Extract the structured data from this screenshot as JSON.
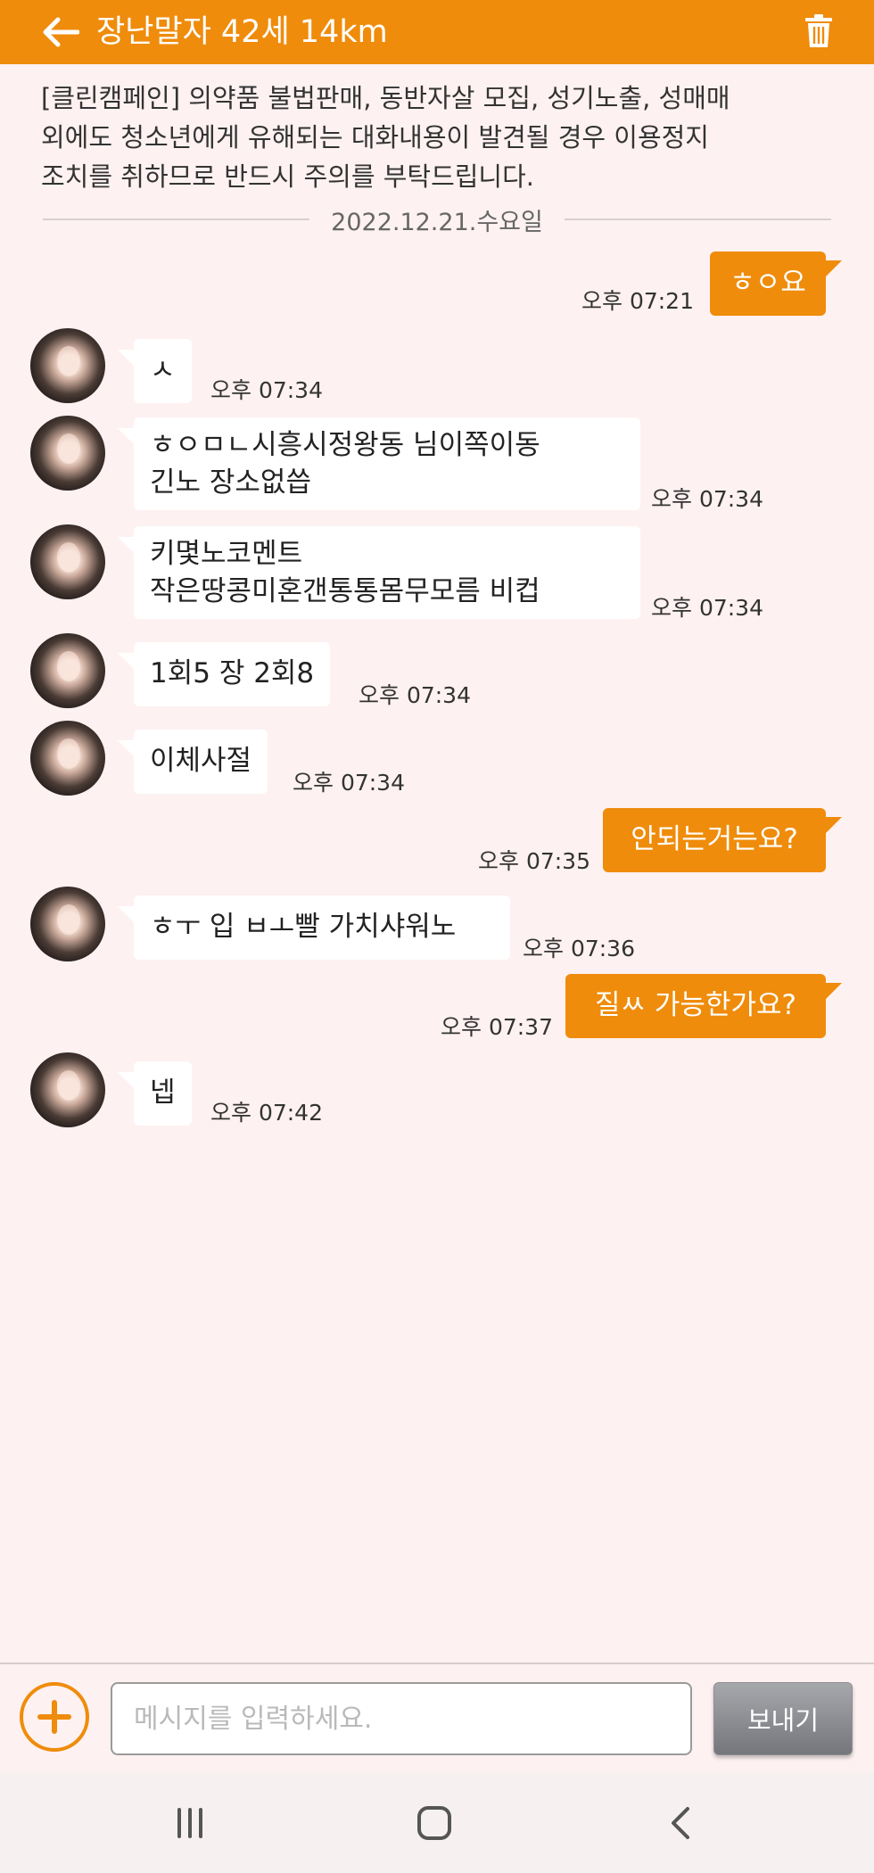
{
  "header": {
    "title": "장난말자 42세 14km",
    "back_icon": "arrow-left-icon",
    "trash_icon": "trash-icon",
    "color": "#ef8c0b"
  },
  "notice": {
    "lines": [
      "[클린캠페인] 의약품 불법판매, 동반자살 모집, 성기노출, 성매매",
      "외에도 청소년에게 유해되는 대화내용이 발견될 경우 이용정지",
      "조치를 취하므로 반드시 주의를 부탁드립니다."
    ]
  },
  "date_separator": "2022.12.21.수요일",
  "messages": [
    {
      "dir": "out",
      "lines": [
        "ㅎㅇ요"
      ],
      "time": "오후 07:21"
    },
    {
      "dir": "in",
      "lines": [
        "ㅅ"
      ],
      "time": "오후 07:34"
    },
    {
      "dir": "in",
      "lines": [
        "ㅎㅇㅁㄴ시흥시정왕동 님이쪽이동",
        "긴노 장소없씁"
      ],
      "time": "오후 07:34"
    },
    {
      "dir": "in",
      "lines": [
        "키몇노코멘트",
        "작은땅콩미혼갠통통몸무모름 비컵"
      ],
      "time": "오후 07:34"
    },
    {
      "dir": "in",
      "lines": [
        "1회5 장  2회8"
      ],
      "time": "오후 07:34"
    },
    {
      "dir": "in",
      "lines": [
        "이체사절"
      ],
      "time": "오후 07:34"
    },
    {
      "dir": "out",
      "lines": [
        "안되는거는요?"
      ],
      "time": "오후 07:35"
    },
    {
      "dir": "in",
      "lines": [
        "ㅎㅜ 입  ㅂㅗ빨 가치샤워노"
      ],
      "time": "오후 07:36"
    },
    {
      "dir": "out",
      "lines": [
        "질ㅆ 가능한가요?"
      ],
      "time": "오후 07:37"
    },
    {
      "dir": "in",
      "lines": [
        "넵"
      ],
      "time": "오후 07:42"
    }
  ],
  "input": {
    "placeholder": "메시지를 입력하세요.",
    "value": "",
    "plus_icon": "plus-circle-icon",
    "send_label": "보내기"
  },
  "nav": {
    "recent_icon": "recent-apps-icon",
    "home_icon": "home-icon",
    "back_icon": "nav-back-icon"
  }
}
